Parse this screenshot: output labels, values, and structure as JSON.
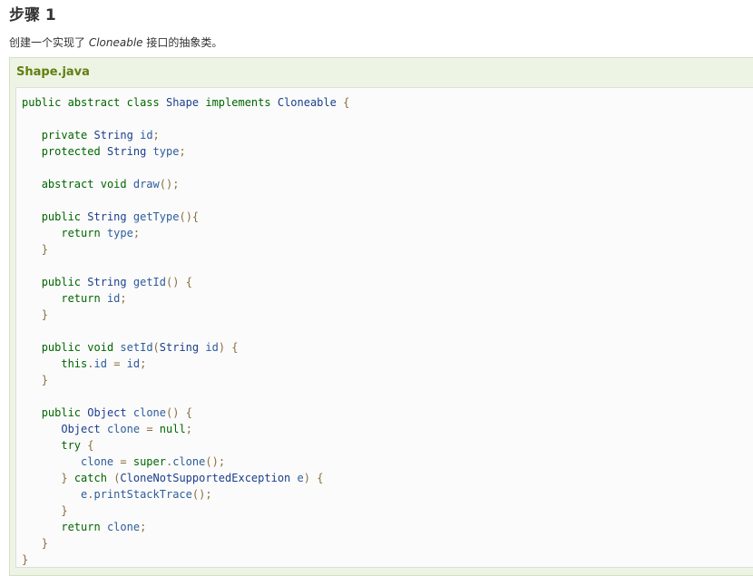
{
  "heading": "步骤 1",
  "description": {
    "before": "创建一个实现了 ",
    "emphasis": "Cloneable",
    "after": " 接口的抽象类。"
  },
  "example": {
    "title": "Shape.java",
    "code_lines": [
      "public abstract class Shape implements Cloneable {",
      "",
      "   private String id;",
      "   protected String type;",
      "",
      "   abstract void draw();",
      "",
      "   public String getType(){",
      "      return type;",
      "   }",
      "",
      "   public String getId() {",
      "      return id;",
      "   }",
      "",
      "   public void setId(String id) {",
      "      this.id = id;",
      "   }",
      "",
      "   public Object clone() {",
      "      Object clone = null;",
      "      try {",
      "         clone = super.clone();",
      "      } catch (CloneNotSupportedException e) {",
      "         e.printStackTrace();",
      "      }",
      "      return clone;",
      "   }",
      "}"
    ]
  },
  "colors": {
    "keyword": "#006600",
    "type": "#1a3f8b",
    "punctuation": "#8a6d3b",
    "title_green": "#617f10",
    "panel_bg": "#eef4e4"
  }
}
